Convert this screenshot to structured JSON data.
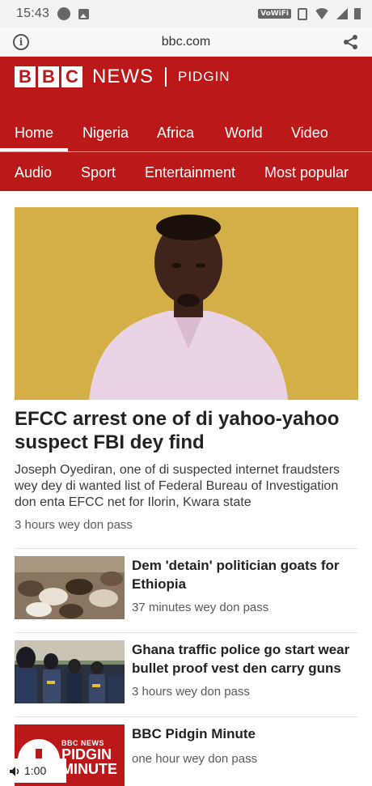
{
  "status_bar": {
    "time": "15:43",
    "network_label": "VoWiFi",
    "icons": [
      "notification-icon",
      "gallery-icon",
      "vowifi-icon",
      "vibrate-icon",
      "wifi-icon",
      "signal-icon",
      "battery-icon"
    ]
  },
  "browser": {
    "url": "bbc.com",
    "info_icon": "info-icon",
    "share_icon": "share-icon"
  },
  "brand": {
    "letters": [
      "B",
      "B",
      "C"
    ],
    "news": "NEWS",
    "section": "PIDGIN",
    "color": "#bb1919"
  },
  "nav": {
    "row1": [
      "Home",
      "Nigeria",
      "Africa",
      "World",
      "Video"
    ],
    "row2": [
      "Audio",
      "Sport",
      "Entertainment",
      "Most popular"
    ],
    "active": "Home"
  },
  "main_story": {
    "title": "EFCC arrest one of di yahoo-yahoo suspect FBI dey find",
    "summary": "Joseph Oyediran, one of di suspected internet fraudsters wey dey di wanted list of Federal Bureau of Investigation don enta EFCC net for Ilorin, Kwara state",
    "time": "3 hours wey don pass"
  },
  "stories": [
    {
      "title": "Dem 'detain' politician goats for Ethiopia",
      "time": "37 minutes wey don pass"
    },
    {
      "title": "Ghana traffic police go start wear bullet proof vest den carry guns",
      "time": "3 hours wey don pass"
    },
    {
      "title": "BBC Pidgin Minute",
      "time": "one hour wey don pass"
    }
  ],
  "pidgin_minute_thumb": {
    "logo_text": "BBC NEWS",
    "line1": "PIDGIN",
    "line2": "MINUTE"
  },
  "media": {
    "duration": "1:00",
    "icon": "speaker-icon"
  }
}
